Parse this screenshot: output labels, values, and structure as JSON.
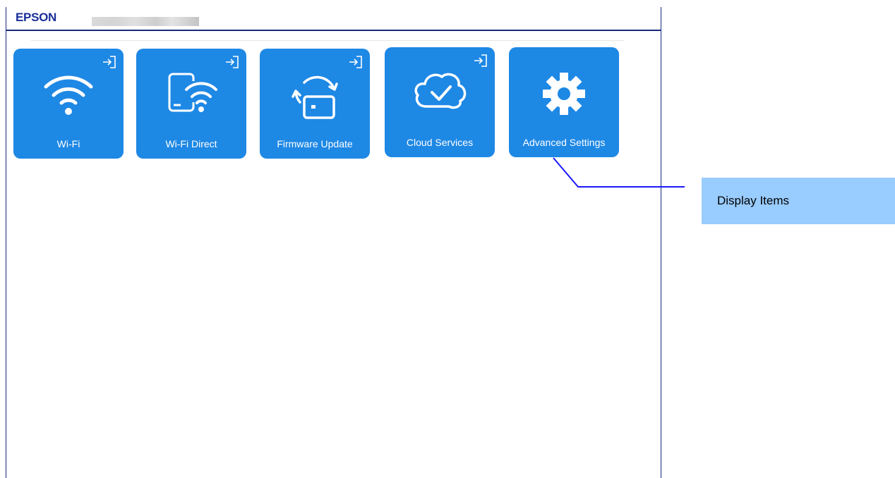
{
  "header": {
    "logo": "EPSON"
  },
  "tiles": [
    {
      "label": "Wi-Fi",
      "icon": "wifi-icon"
    },
    {
      "label": "Wi-Fi Direct",
      "icon": "wifi-direct-icon"
    },
    {
      "label": "Firmware Update",
      "icon": "firmware-update-icon"
    },
    {
      "label": "Cloud Services",
      "icon": "cloud-services-icon"
    },
    {
      "label": "Advanced Settings",
      "icon": "gear-icon"
    }
  ],
  "callout": {
    "label": "Display Items"
  },
  "colors": {
    "tile": "#1e88e5",
    "brand": "#1a2f9a",
    "callout_box": "#99ccff",
    "callout_line": "#1a1aff"
  }
}
